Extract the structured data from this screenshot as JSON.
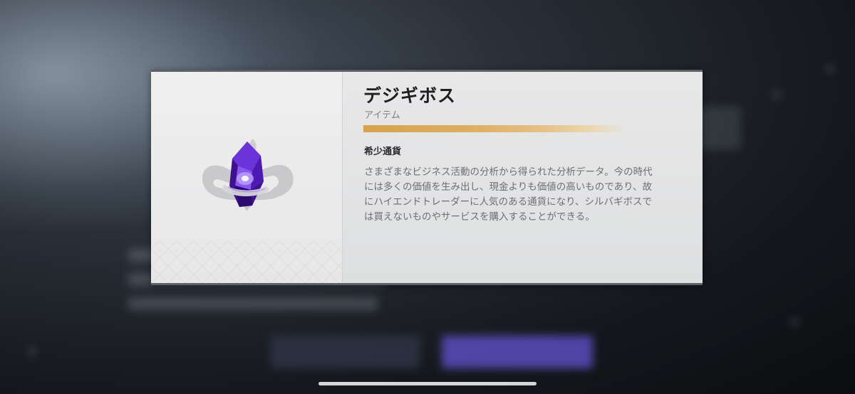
{
  "background": {
    "title": "",
    "buttons": {
      "cancel_label": "",
      "buy_label": ""
    }
  },
  "item": {
    "name": "デジギボス",
    "type": "アイテム",
    "category": "希少通貨",
    "rarity_fill": 0.72,
    "rarity_color": "#d9aa55",
    "description": "さまざまなビジネス活動の分析から得られた分析データ。今の時代\nには多くの価値を生み出し、現金よりも価値の高いものであり、故\nにハイエンドトレーダーに人気のある通貨になり、シルバギボスで\nは買えないものやサービスを購入することができる。",
    "icon": "purple-crystal-icon",
    "crystal_color": "#6b2fd6"
  },
  "modal_border_color": "#5c6168"
}
